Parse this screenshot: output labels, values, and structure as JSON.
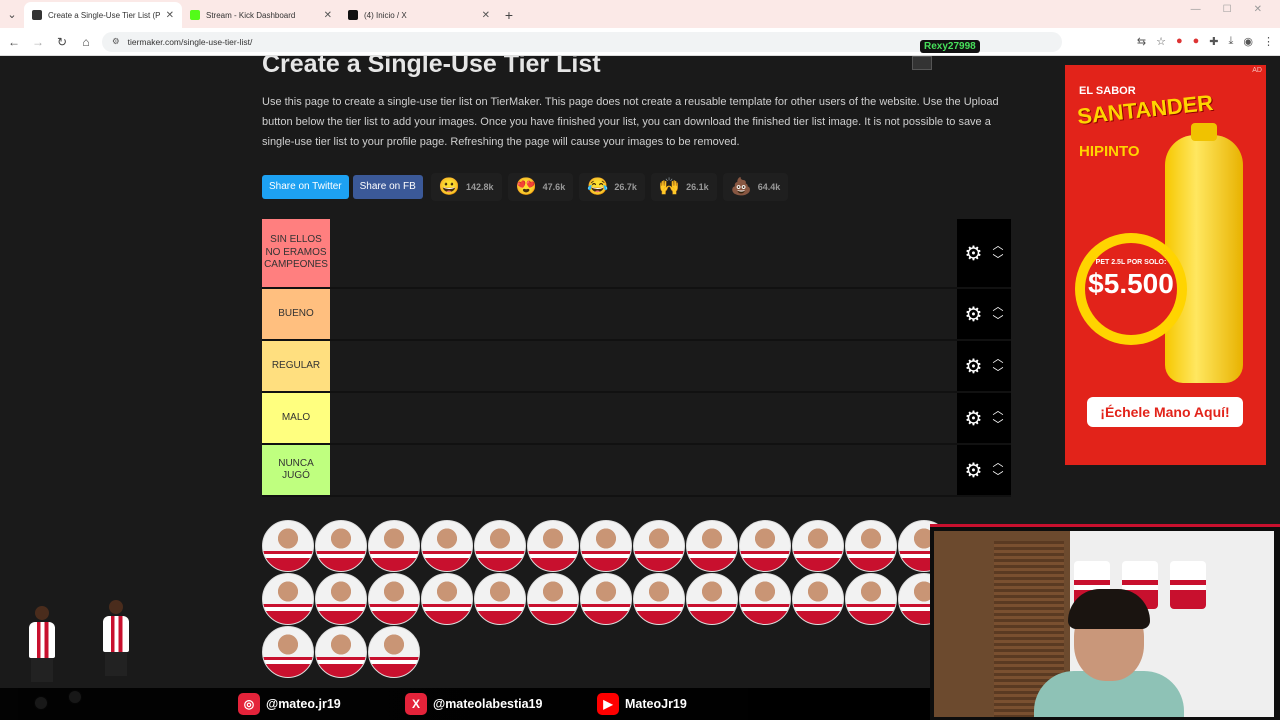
{
  "browser": {
    "tabs": [
      {
        "title": "Create a Single-Use Tier List (P",
        "icon": "tiermaker-icon",
        "fav": "#333333",
        "active": true
      },
      {
        "title": "Stream - Kick Dashboard",
        "icon": "kick-icon",
        "fav": "#53fc18",
        "active": false
      },
      {
        "title": "(4) Inicio / X",
        "icon": "x-icon",
        "fav": "#111111",
        "active": false
      }
    ],
    "new_tab": "+",
    "url": "tiermaker.com/single-use-tier-list/"
  },
  "page": {
    "title": "Create a Single-Use Tier List",
    "description": "Use this page to create a single-use tier list on TierMaker. This page does not create a reusable template for other users of the website. Use the Upload button below the tier list to add your images. Once you have finished your list, you can download the finished tier list image. It is not possible to save a single-use tier list to your profile page. Refreshing the page will cause your images to be removed.",
    "share_twitter": "Share on Twitter",
    "share_fb": "Share on FB",
    "reactions": [
      {
        "emoji": "😀",
        "count": "142.8k",
        "icon": "grin-emoji-icon"
      },
      {
        "emoji": "😍",
        "count": "47.6k",
        "icon": "heart-eyes-emoji-icon"
      },
      {
        "emoji": "😂",
        "count": "26.7k",
        "icon": "laugh-emoji-icon"
      },
      {
        "emoji": "🙌",
        "count": "26.1k",
        "icon": "raised-hands-emoji-icon"
      },
      {
        "emoji": "💩",
        "count": "64.4k",
        "icon": "poop-emoji-icon"
      }
    ]
  },
  "tiers": [
    {
      "label": "SIN ELLOS NO ERAMOS CAMPEONES",
      "color": "#ff7f7f"
    },
    {
      "label": "BUENO",
      "color": "#ffbf7f"
    },
    {
      "label": "REGULAR",
      "color": "#ffdf7f"
    },
    {
      "label": "MALO",
      "color": "#ffff7f"
    },
    {
      "label": "NUNCA JUGÓ",
      "color": "#bfff7f"
    }
  ],
  "pool_rows": [
    13,
    13,
    3
  ],
  "ad": {
    "line1": "EL SABOR",
    "brand": "SANTANDER",
    "sub": "HIPINTO",
    "pet": "PET 2.5L POR SOLO:",
    "price": "$5.500",
    "cta": "¡Échele Mano Aquí!",
    "label": "AD"
  },
  "overlay": {
    "viewer": "Rexy27998"
  },
  "social": [
    {
      "handle": "@mateo.jr19",
      "icon": "instagram-icon",
      "color": "#e4233a",
      "glyph": "◎"
    },
    {
      "handle": "@mateolabestia19",
      "icon": "x-icon",
      "color": "#e4233a",
      "glyph": "X"
    },
    {
      "handle": "MateoJr19",
      "icon": "youtube-icon",
      "color": "#ff0000",
      "glyph": "▶"
    }
  ]
}
